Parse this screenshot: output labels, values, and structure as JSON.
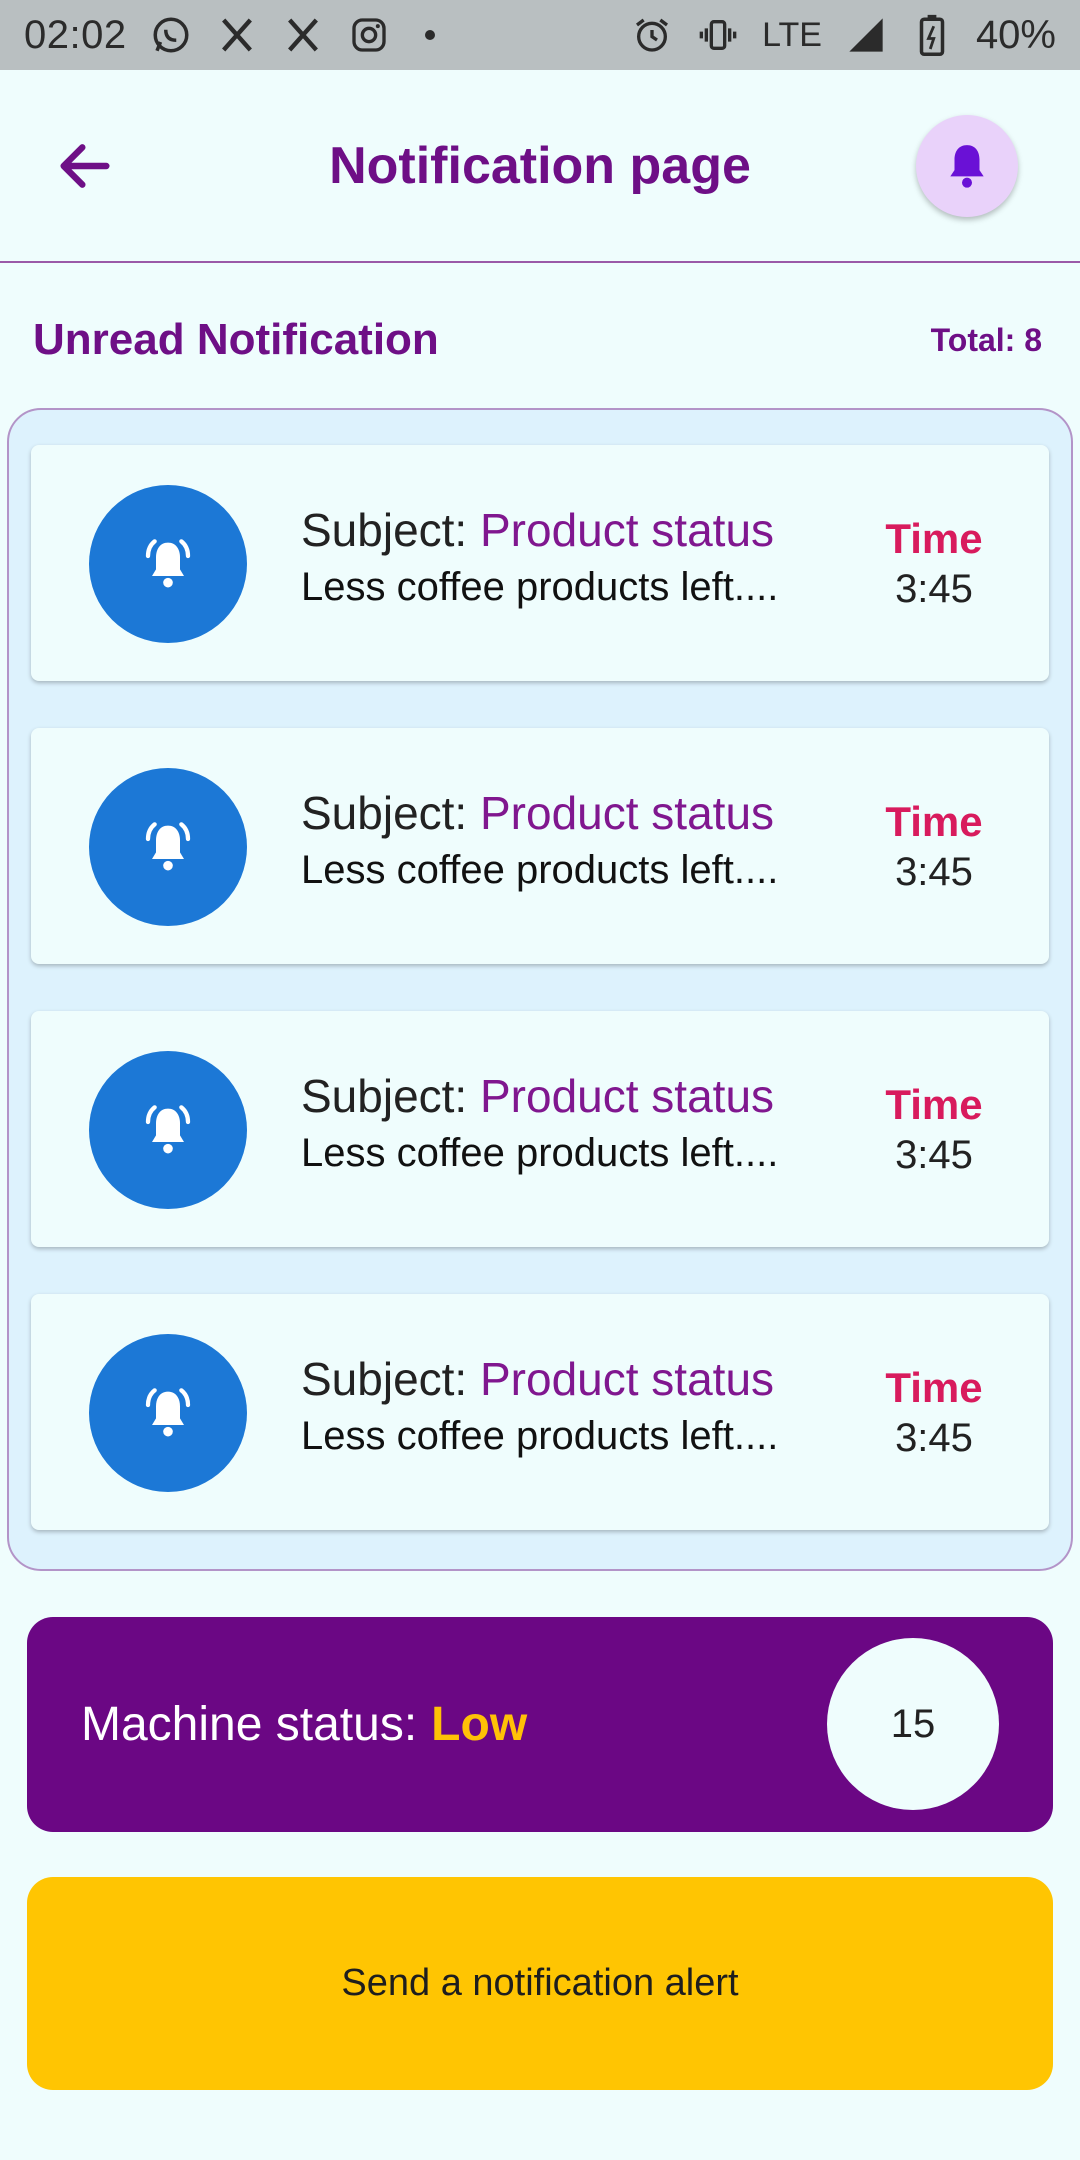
{
  "status_bar": {
    "time": "02:02",
    "network": "LTE",
    "battery": "40%",
    "icons": [
      "whatsapp-icon",
      "x-icon",
      "x-icon",
      "instagram-icon",
      "dot-icon",
      "alarm-icon",
      "vibrate-icon",
      "signal-icon",
      "battery-icon"
    ]
  },
  "header": {
    "title": "Notification page",
    "back_icon": "arrow-left-icon",
    "bell_icon": "bell-icon"
  },
  "section": {
    "title": "Unread Notification",
    "total": "Total: 8"
  },
  "notifications": [
    {
      "subject_label": "Subject:",
      "subject_value": "Product status",
      "body": "Less coffee products left....",
      "time_label": "Time",
      "time_value": "3:45"
    },
    {
      "subject_label": "Subject:",
      "subject_value": "Product status",
      "body": "Less coffee products left....",
      "time_label": "Time",
      "time_value": "3:45"
    },
    {
      "subject_label": "Subject:",
      "subject_value": "Product status",
      "body": "Less coffee products left....",
      "time_label": "Time",
      "time_value": "3:45"
    },
    {
      "subject_label": "Subject:",
      "subject_value": "Product status",
      "body": "Less coffee products left....",
      "time_label": "Time",
      "time_value": "3:45"
    }
  ],
  "machine_status": {
    "label": "Machine status:",
    "value": "Low",
    "count": "15"
  },
  "alert_button": {
    "label": "Send a notification alert"
  },
  "colors": {
    "primary": "#6e0f86",
    "accent": "#ffc107",
    "avatar": "#1c78d6",
    "time_label": "#d81b5d",
    "background": "#effdfd"
  }
}
